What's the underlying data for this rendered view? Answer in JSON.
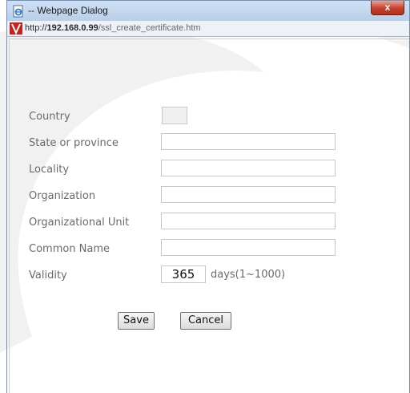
{
  "window": {
    "title": "-- Webpage Dialog",
    "close_glyph": "x",
    "icon": "ie-page-icon"
  },
  "address": {
    "scheme": "http://",
    "host": "192.168.0.99",
    "path": "/ssl_create_certificate.htm",
    "icon": "vivotek-logo-icon"
  },
  "form": {
    "country_label": "Country",
    "state_label": "State or province",
    "locality_label": "Locality",
    "organization_label": "Organization",
    "org_unit_label": "Organizational Unit",
    "common_name_label": "Common Name",
    "validity_label": "Validity",
    "country_value": "",
    "state_value": "",
    "locality_value": "",
    "organization_value": "",
    "org_unit_value": "",
    "common_name_value": "",
    "validity_value": "365",
    "validity_suffix": "days(1~1000)"
  },
  "buttons": {
    "save_label": "Save",
    "cancel_label": "Cancel"
  },
  "colors": {
    "titlebar": "#b9cfe8",
    "close_button": "#c4402a",
    "label_text": "#6a6a6a"
  }
}
